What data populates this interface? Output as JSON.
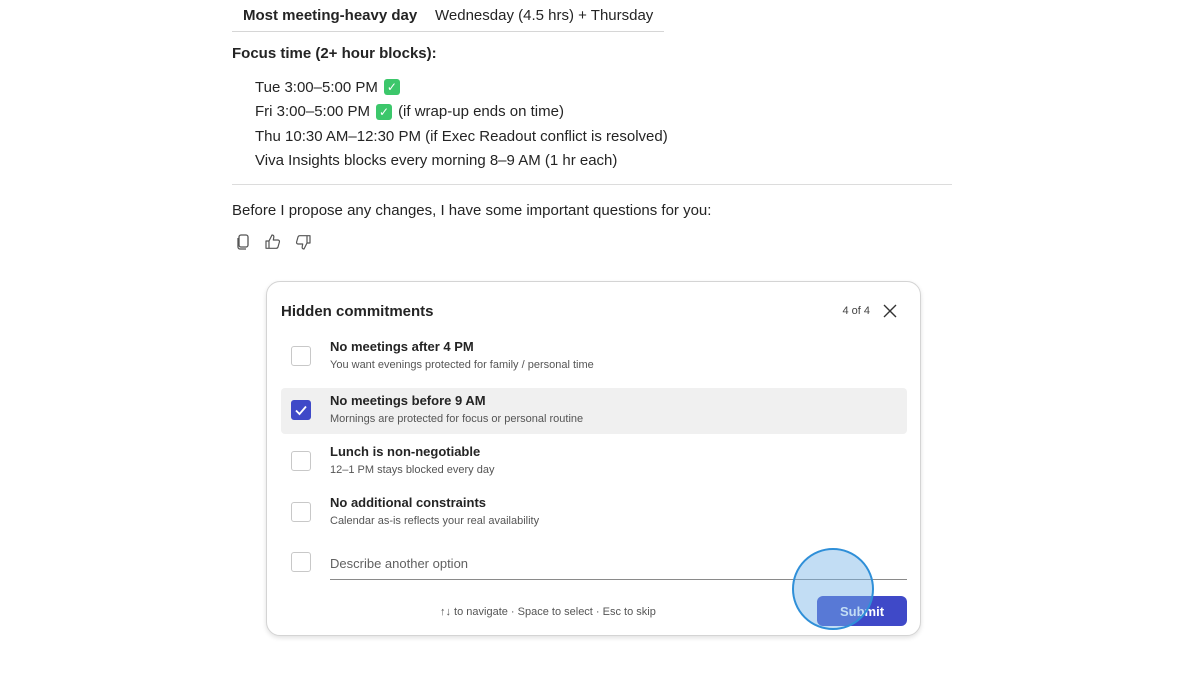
{
  "summary": {
    "key": "Most meeting-heavy day",
    "value": "Wednesday (4.5 hrs) + Thursday"
  },
  "focus": {
    "heading": "Focus time (2+ hour blocks):",
    "items": [
      {
        "text": "Tue 3:00–5:00 PM",
        "check": true,
        "suffix": ""
      },
      {
        "text": "Fri 3:00–5:00 PM",
        "check": true,
        "suffix": "(if wrap-up ends on time)"
      },
      {
        "text": "Thu 10:30 AM–12:30 PM (if Exec Readout conflict is resolved)",
        "check": false,
        "suffix": ""
      },
      {
        "text": "Viva Insights blocks every morning 8–9 AM (1 hr each)",
        "check": false,
        "suffix": ""
      }
    ],
    "check_glyph": "✓"
  },
  "question": "Before I propose any changes, I have some important questions for you:",
  "actions": {
    "copy_icon": "copy-icon",
    "like_icon": "thumbs-up-icon",
    "dislike_icon": "thumbs-down-icon"
  },
  "dialog": {
    "title": "Hidden commitments",
    "counter": "4 of 4",
    "options": [
      {
        "title": "No meetings after 4 PM",
        "desc": "You want evenings protected for family / personal time",
        "checked": false
      },
      {
        "title": "No meetings before 9 AM",
        "desc": "Mornings are protected for focus or personal routine",
        "checked": true
      },
      {
        "title": "Lunch is non-negotiable",
        "desc": "12–1 PM stays blocked every day",
        "checked": false
      },
      {
        "title": "No additional constraints",
        "desc": "Calendar as-is reflects your real availability",
        "checked": false
      }
    ],
    "other_placeholder": "Describe another option",
    "other_value": "",
    "hint": "↑↓ to navigate · Space to select · Esc to skip",
    "submit_label": "Submit"
  },
  "colors": {
    "accent": "#3f49c8",
    "check_green": "#3cc76b",
    "selected_bg": "#f0f0f0"
  }
}
